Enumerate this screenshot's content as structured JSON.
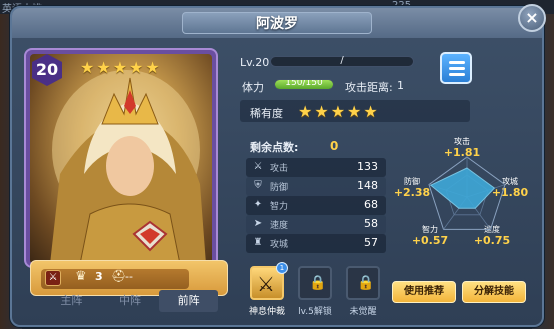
{
  "background": {
    "left_text": "英语大挑",
    "right_text": "225"
  },
  "window": {
    "title": "阿波罗",
    "close_label": "×"
  },
  "card": {
    "level": "20",
    "stars": [
      "★",
      "★",
      "★",
      "★",
      "★"
    ],
    "crown_count": "3",
    "helm_text": "--",
    "weapon_icon": "weapon-icon",
    "positions": [
      "主阵",
      "中阵",
      "前阵"
    ],
    "active_position": "前阵"
  },
  "stats": {
    "lv_label": "Lv.20",
    "xp_text": "/",
    "hp_label": "体力",
    "hp_text": "150/150",
    "hp_fill": 1.0,
    "range_label": "攻击距离:",
    "range_value": "1",
    "rarity_label": "稀有度",
    "rarity_stars": [
      "★",
      "★",
      "★",
      "★",
      "★"
    ],
    "points_label": "剩余点数:",
    "points_value": "0",
    "rows": [
      {
        "icon": "sword-icon",
        "glyph": "⚔",
        "name": "攻击",
        "value": "133"
      },
      {
        "icon": "shield-icon",
        "glyph": "⛨",
        "name": "防御",
        "value": "148"
      },
      {
        "icon": "brain-icon",
        "glyph": "✦",
        "name": "智力",
        "value": "68"
      },
      {
        "icon": "boot-icon",
        "glyph": "➤",
        "name": "速度",
        "value": "58"
      },
      {
        "icon": "castle-icon",
        "glyph": "♜",
        "name": "攻城",
        "value": "57"
      }
    ]
  },
  "radar": {
    "labels": {
      "attack": "攻击",
      "siege": "攻城",
      "speed": "速度",
      "intellect": "智力",
      "defense": "防御"
    },
    "bonuses": {
      "attack": "+1.81",
      "siege": "+1.80",
      "speed": "+0.75",
      "intellect": "+0.57",
      "defense": "+2.38"
    },
    "values": {
      "attack": 1.81,
      "siege": 1.8,
      "speed": 0.75,
      "intellect": 0.57,
      "defense": 2.38
    },
    "fill_color": "#3ea8d8"
  },
  "skills": [
    {
      "name": "神息仲裁",
      "locked": false,
      "badge": "1"
    },
    {
      "name": "lv.5解锁",
      "locked": true
    },
    {
      "name": "未觉醒",
      "locked": true
    }
  ],
  "buttons": {
    "recommend": "使用推荐",
    "decompose": "分解技能"
  },
  "colors": {
    "accent_gold": "#ffd24a",
    "hp_green": "#7cc443",
    "button_gold": "#f3b43a",
    "card_purple": "#6a4ea0"
  }
}
